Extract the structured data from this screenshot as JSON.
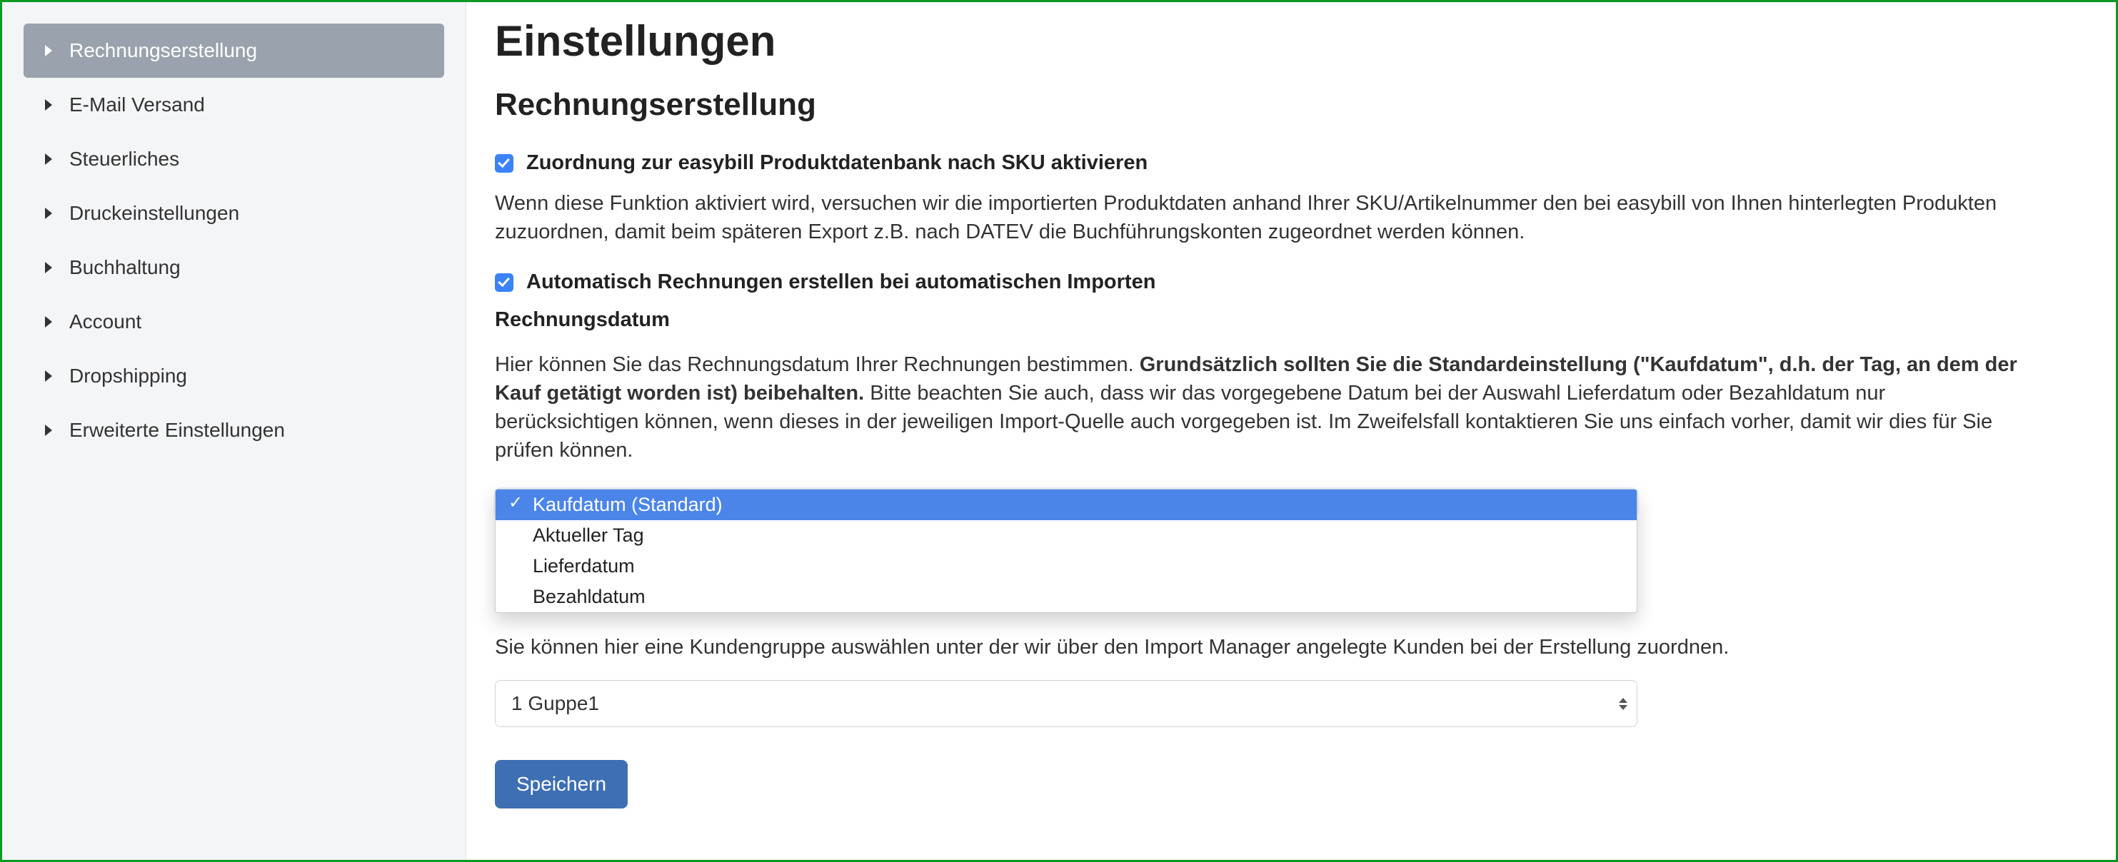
{
  "page": {
    "title": "Einstellungen",
    "section_title": "Rechnungserstellung"
  },
  "sidebar": {
    "items": [
      {
        "label": "Rechnungserstellung",
        "active": true
      },
      {
        "label": "E-Mail Versand"
      },
      {
        "label": "Steuerliches"
      },
      {
        "label": "Druckeinstellungen"
      },
      {
        "label": "Buchhaltung"
      },
      {
        "label": "Account"
      },
      {
        "label": "Dropshipping"
      },
      {
        "label": "Erweiterte Einstellungen"
      }
    ]
  },
  "settings": {
    "sku_checkbox_label": "Zuordnung zur easybill Produktdatenbank nach SKU aktivieren",
    "sku_checkbox_checked": true,
    "sku_help": "Wenn diese Funktion aktiviert wird, versuchen wir die importierten Produktdaten anhand Ihrer SKU/Artikelnummer den bei easybill von Ihnen hinterlegten Produkten zuzuordnen, damit beim späteren Export z.B. nach DATEV die Buchführungskonten zugeordnet werden können.",
    "auto_checkbox_label": "Automatisch Rechnungen erstellen bei automatischen Importen",
    "auto_checkbox_checked": true,
    "invoice_date_heading": "Rechnungsdatum",
    "invoice_date_help_prefix": "Hier können Sie das Rechnungsdatum Ihrer Rechnungen bestimmen. ",
    "invoice_date_help_bold": "Grundsätzlich sollten Sie die Standardeinstellung (\"Kaufdatum\", d.h. der Tag, an dem der Kauf getätigt worden ist) beibehalten.",
    "invoice_date_help_suffix": " Bitte beachten Sie auch, dass wir das vorgegebene Datum bei der Auswahl Lieferdatum oder Bezahldatum nur berücksichtigen können, wenn dieses in der jeweiligen Import-Quelle auch vorgegeben ist. Im Zweifelsfall kontaktieren Sie uns einfach vorher, damit wir dies für Sie prüfen können.",
    "invoice_date_options": [
      "Kaufdatum (Standard)",
      "Aktueller Tag",
      "Lieferdatum",
      "Bezahldatum"
    ],
    "invoice_date_selected": "Kaufdatum (Standard)",
    "customer_group_help": "Sie können hier eine Kundengruppe auswählen unter der wir über den Import Manager angelegte Kunden bei der Erstellung zuordnen.",
    "customer_group_selected": "1 Guppe1",
    "save_label": "Speichern"
  }
}
